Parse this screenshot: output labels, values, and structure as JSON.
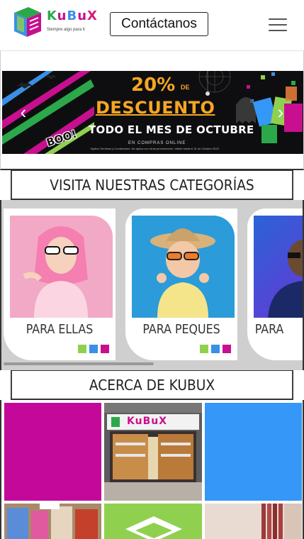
{
  "header": {
    "logo_text": [
      "K",
      "u",
      "B",
      "u",
      "X"
    ],
    "logo_tagline": "Siempre algo para ti",
    "contact_label": "Contáctanos"
  },
  "banner": {
    "percent": "20%",
    "percent_suffix": "DE",
    "title": "DESCUENTO",
    "subtitle": "TODO EL MES DE OCTUBRE",
    "online": "EN COMPRAS ONLINE",
    "fine_print": "*Aplica Términos y Condiciones. No aplica con otras promociones. Válido hasta el 31 de Octubre 2023",
    "boo": "BOO!",
    "prev_symbol": "‹",
    "next_symbol": "›"
  },
  "categories": {
    "heading": "VISITA NUESTRAS CATEGORÍAS",
    "items": [
      {
        "label": "PARA ELLAS"
      },
      {
        "label": "PARA PEQUES"
      },
      {
        "label": "PARA"
      }
    ],
    "swatch_colors": [
      "#8fd14f",
      "#3a8fe6",
      "#c80f8f"
    ]
  },
  "about": {
    "heading": "ACERCA DE KUBUX",
    "store_sign": "KuBuX",
    "tile_colors": {
      "magenta": "#c4089a",
      "blue": "#3597f7",
      "green": "#8fd14f"
    }
  }
}
